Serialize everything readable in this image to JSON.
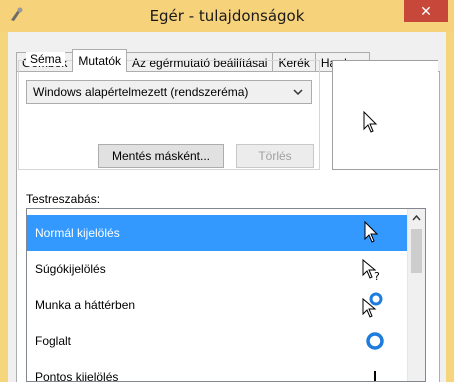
{
  "window": {
    "title": "Egér - tulajdonságok",
    "close_label": "✕"
  },
  "tabs": [
    {
      "label": "Gombok",
      "active": false
    },
    {
      "label": "Mutatók",
      "active": true
    },
    {
      "label": "Az egérmutató beállításai",
      "active": false
    },
    {
      "label": "Kerék",
      "active": false
    },
    {
      "label": "Hardver",
      "active": false
    }
  ],
  "scheme": {
    "legend": "Séma",
    "selected": "Windows alapértelmezett (rendszeréma)",
    "save_button": "Mentés másként...",
    "delete_button": "Törlés"
  },
  "customize": {
    "label": "Testreszabás:",
    "items": [
      {
        "label": "Normál kijelölés",
        "icon": "arrow-cursor-icon",
        "selected": true
      },
      {
        "label": "Súgókijelölés",
        "icon": "help-cursor-icon",
        "selected": false
      },
      {
        "label": "Munka a háttérben",
        "icon": "working-background-cursor-icon",
        "selected": false
      },
      {
        "label": "Foglalt",
        "icon": "busy-cursor-icon",
        "selected": false
      },
      {
        "label": "Pontos kijelölés",
        "icon": "precision-cursor-icon",
        "selected": false
      }
    ]
  },
  "colors": {
    "titlebar": "#f6d27a",
    "close": "#c7473a",
    "selection": "#3399ff",
    "busy_ring": "#1e7ddc"
  }
}
